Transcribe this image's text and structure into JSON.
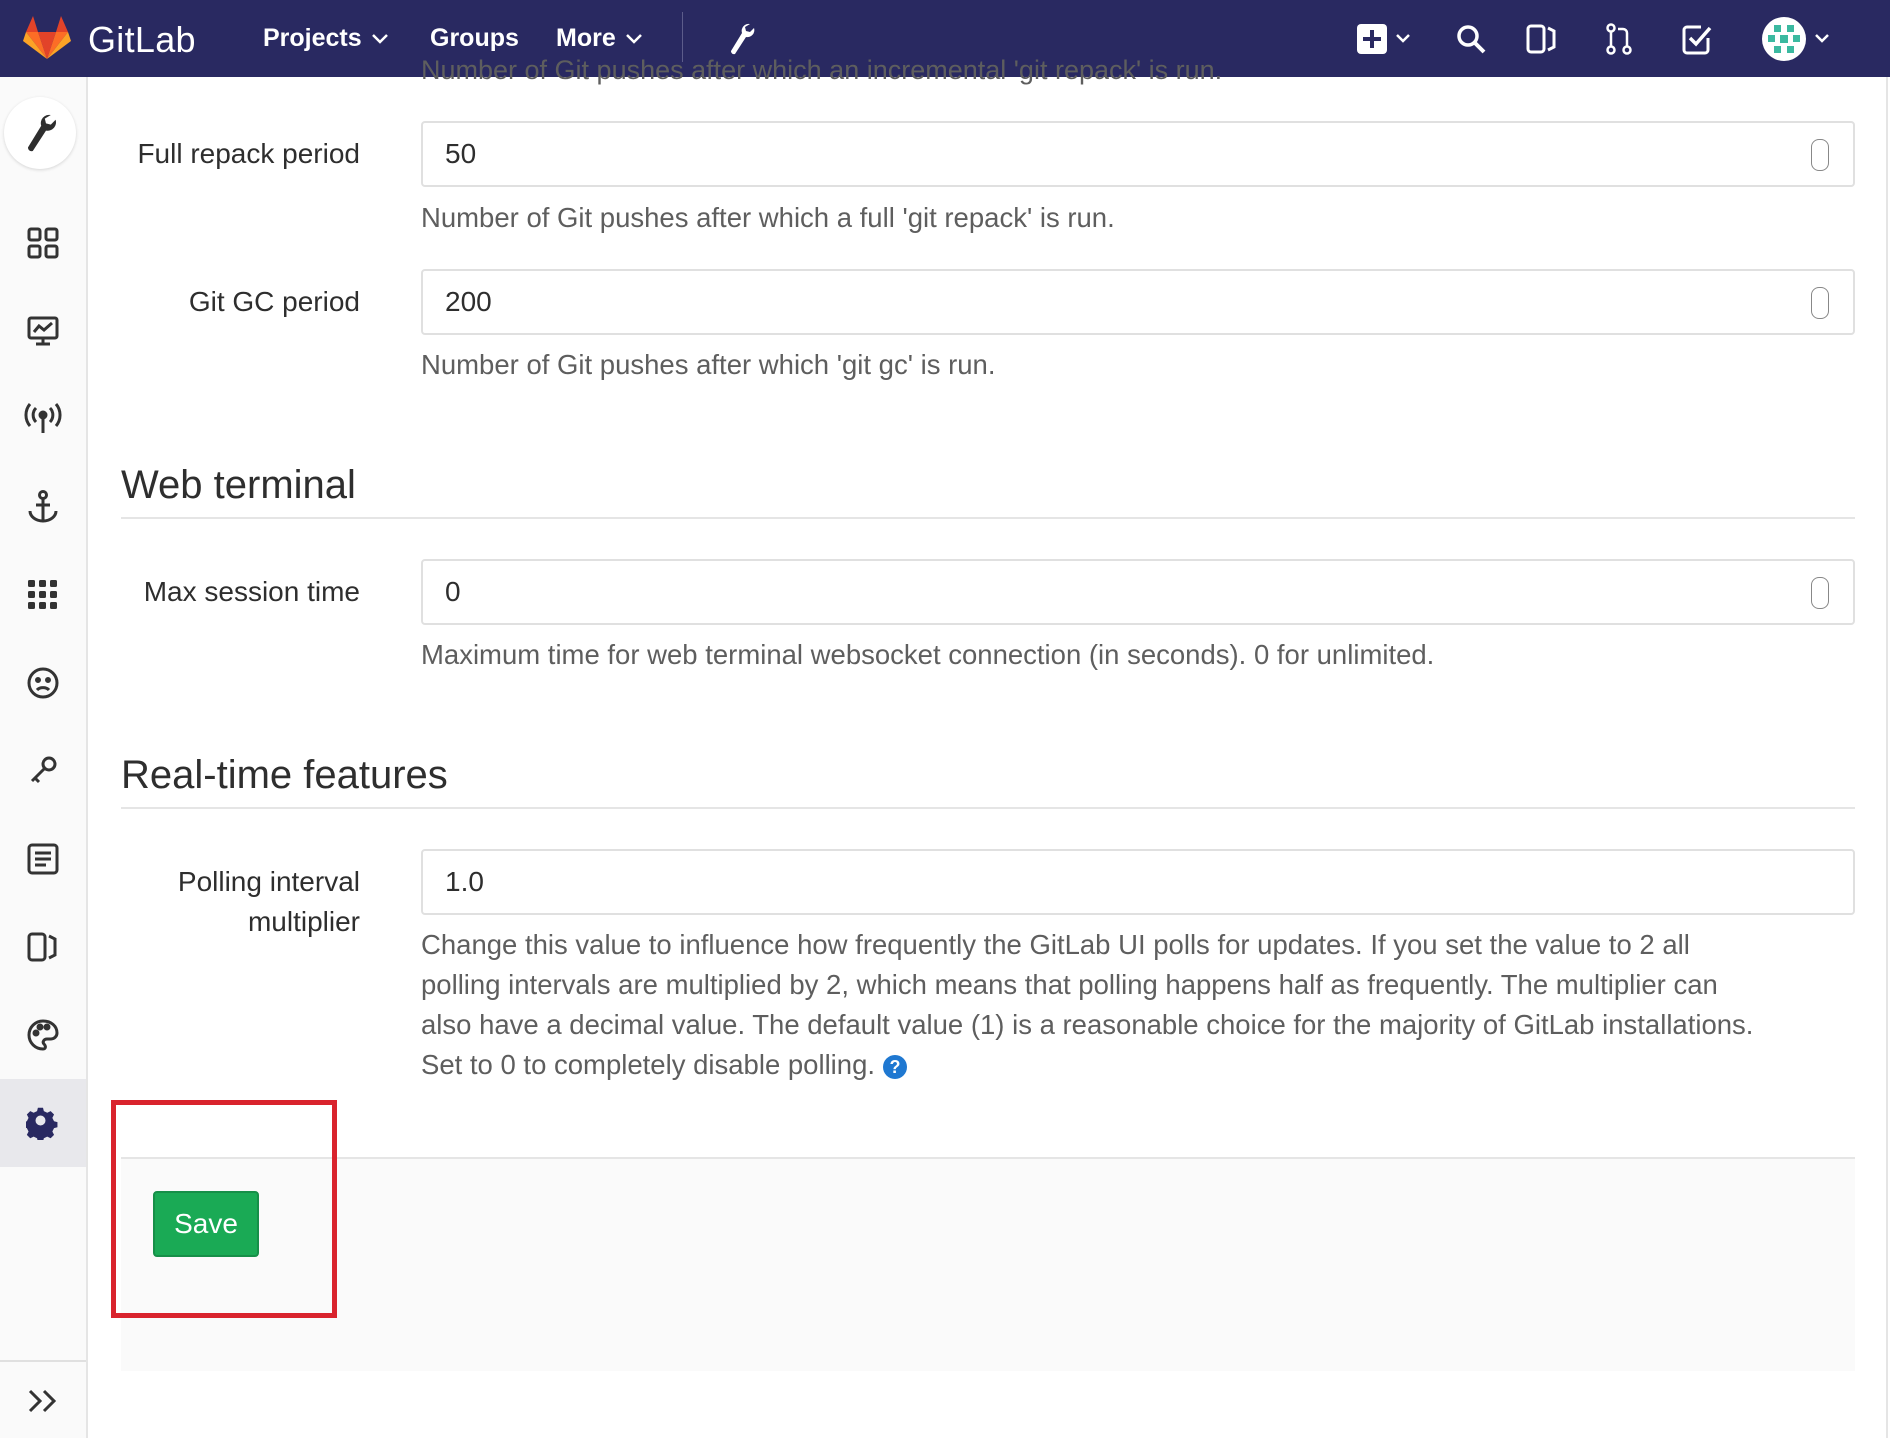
{
  "navbar": {
    "brand": "GitLab",
    "items": [
      {
        "label": "Projects",
        "dropdown": true
      },
      {
        "label": "Groups",
        "dropdown": false
      },
      {
        "label": "More",
        "dropdown": true
      }
    ],
    "icons": [
      "admin-wrench-icon",
      "new-plus-icon",
      "search-icon",
      "issues-icon",
      "merge-requests-icon",
      "todos-icon",
      "user-avatar"
    ],
    "background_color": "#292961"
  },
  "sidebar": {
    "items": [
      "admin-overview-icon",
      "dashboard-grid-icon",
      "monitoring-icon",
      "messages-broadcast-icon",
      "system-hooks-anchor-icon",
      "applications-icon",
      "abuse-reports-icon",
      "deploy-keys-icon",
      "service-templates-icon",
      "labels-icon",
      "appearance-palette-icon",
      "settings-gear-icon"
    ],
    "active": "settings-gear-icon",
    "collapse_icon": "collapse-sidebar-icon"
  },
  "form": {
    "cutoff_help": "Number of Git pushes after which an incremental 'git repack' is run.",
    "housekeeping": {
      "full_repack": {
        "label": "Full repack period",
        "value": "50",
        "help": "Number of Git pushes after which a full 'git repack' is run."
      },
      "git_gc": {
        "label": "Git GC period",
        "value": "200",
        "help": "Number of Git pushes after which 'git gc' is run."
      }
    },
    "web_terminal": {
      "title": "Web terminal",
      "max_session": {
        "label": "Max session time",
        "value": "0",
        "help": "Maximum time for web terminal websocket connection (in seconds). 0 for unlimited."
      }
    },
    "realtime": {
      "title": "Real-time features",
      "polling": {
        "label_line1": "Polling interval",
        "label_line2": "multiplier",
        "value": "1.0",
        "help_line1": "Change this value to influence how frequently the GitLab UI polls for updates. If you set the value to 2 all",
        "help_line2": "polling intervals are multiplied by 2, which means that polling happens half as frequently. The multiplier can",
        "help_line3": "also have a decimal value. The default value (1) is a reasonable choice for the majority of GitLab installations.",
        "help_line4": "Set to 0 to completely disable polling.",
        "help_icon": "?"
      }
    },
    "save_label": "Save",
    "save_color": "#1aaa55",
    "highlight_color": "#d9232d"
  }
}
